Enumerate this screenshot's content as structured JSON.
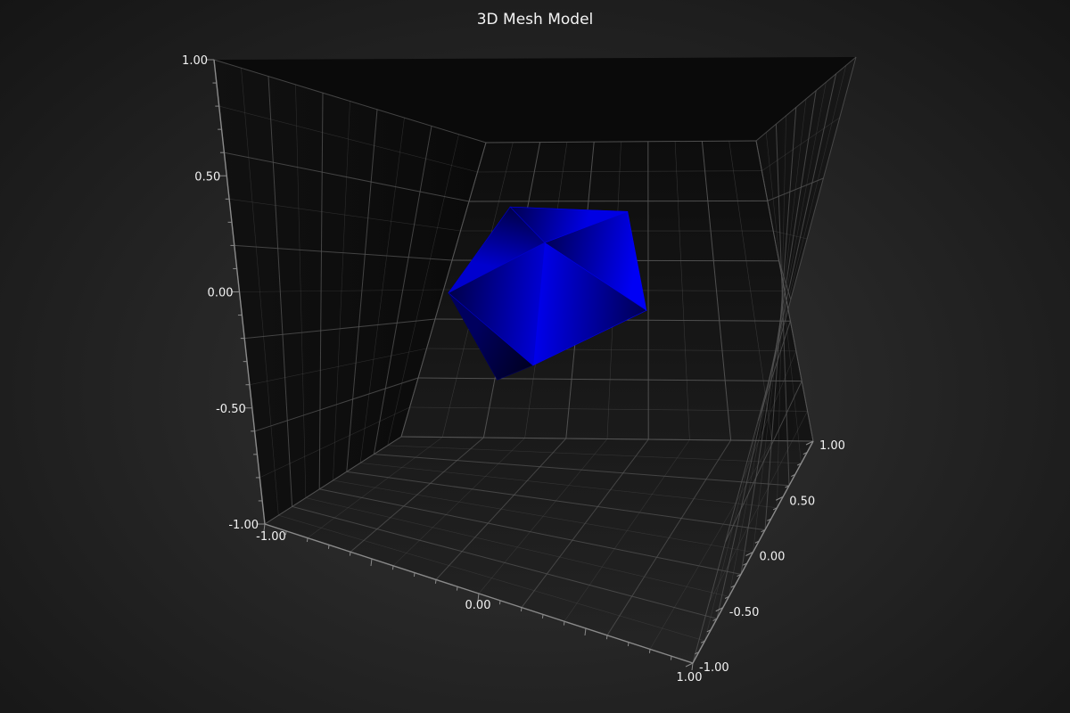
{
  "chart_data": {
    "type": "3d-mesh",
    "title": "3D Mesh Model",
    "axes": {
      "x": {
        "range": [
          -1,
          1
        ],
        "ticks": [
          "-1.00",
          "0.00",
          "1.00"
        ]
      },
      "y": {
        "range": [
          -1,
          1
        ],
        "ticks": [
          "-1.00",
          "-0.50",
          "0.00",
          "0.50",
          "1.00"
        ]
      },
      "z": {
        "range": [
          -1,
          1
        ],
        "ticks": [
          "-1.00",
          "-0.50",
          "0.00",
          "0.50",
          "1.00"
        ]
      }
    },
    "grid": true,
    "mesh": {
      "shape": "icosahedron",
      "color": "#0000ff",
      "center": [
        0,
        0.05,
        0
      ],
      "radius": 0.5
    }
  },
  "colors": {
    "wall_grid": "#565656",
    "axis_line": "#8a8a8a",
    "mesh_base": "#0000ff",
    "background": "#262626"
  }
}
